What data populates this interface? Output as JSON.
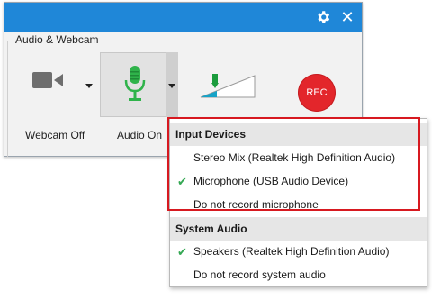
{
  "window": {
    "group_label": "Audio & Webcam",
    "webcam_label": "Webcam Off",
    "audio_label": "Audio On",
    "rec_label": "REC",
    "close_glyph": "✕"
  },
  "menu": {
    "input_header": "Input Devices",
    "input_items": [
      {
        "label": "Stereo Mix (Realtek High Definition Audio)",
        "checked": false
      },
      {
        "label": "Microphone (USB Audio Device)",
        "checked": true
      },
      {
        "label": "Do not record microphone",
        "checked": false
      }
    ],
    "system_header": "System Audio",
    "system_items": [
      {
        "label": "Speakers (Realtek High Definition Audio)",
        "checked": true
      },
      {
        "label": "Do not record system audio",
        "checked": false
      }
    ],
    "check_glyph": "✔"
  },
  "colors": {
    "titlebar": "#1f87d8",
    "rec": "#e3262b",
    "mic": "#2fb34a",
    "highlight": "#d71920"
  },
  "icons": [
    "gear-icon",
    "close-icon",
    "webcam-icon",
    "microphone-icon",
    "volume-level-icon",
    "chevron-down-icon",
    "checkmark-icon"
  ]
}
